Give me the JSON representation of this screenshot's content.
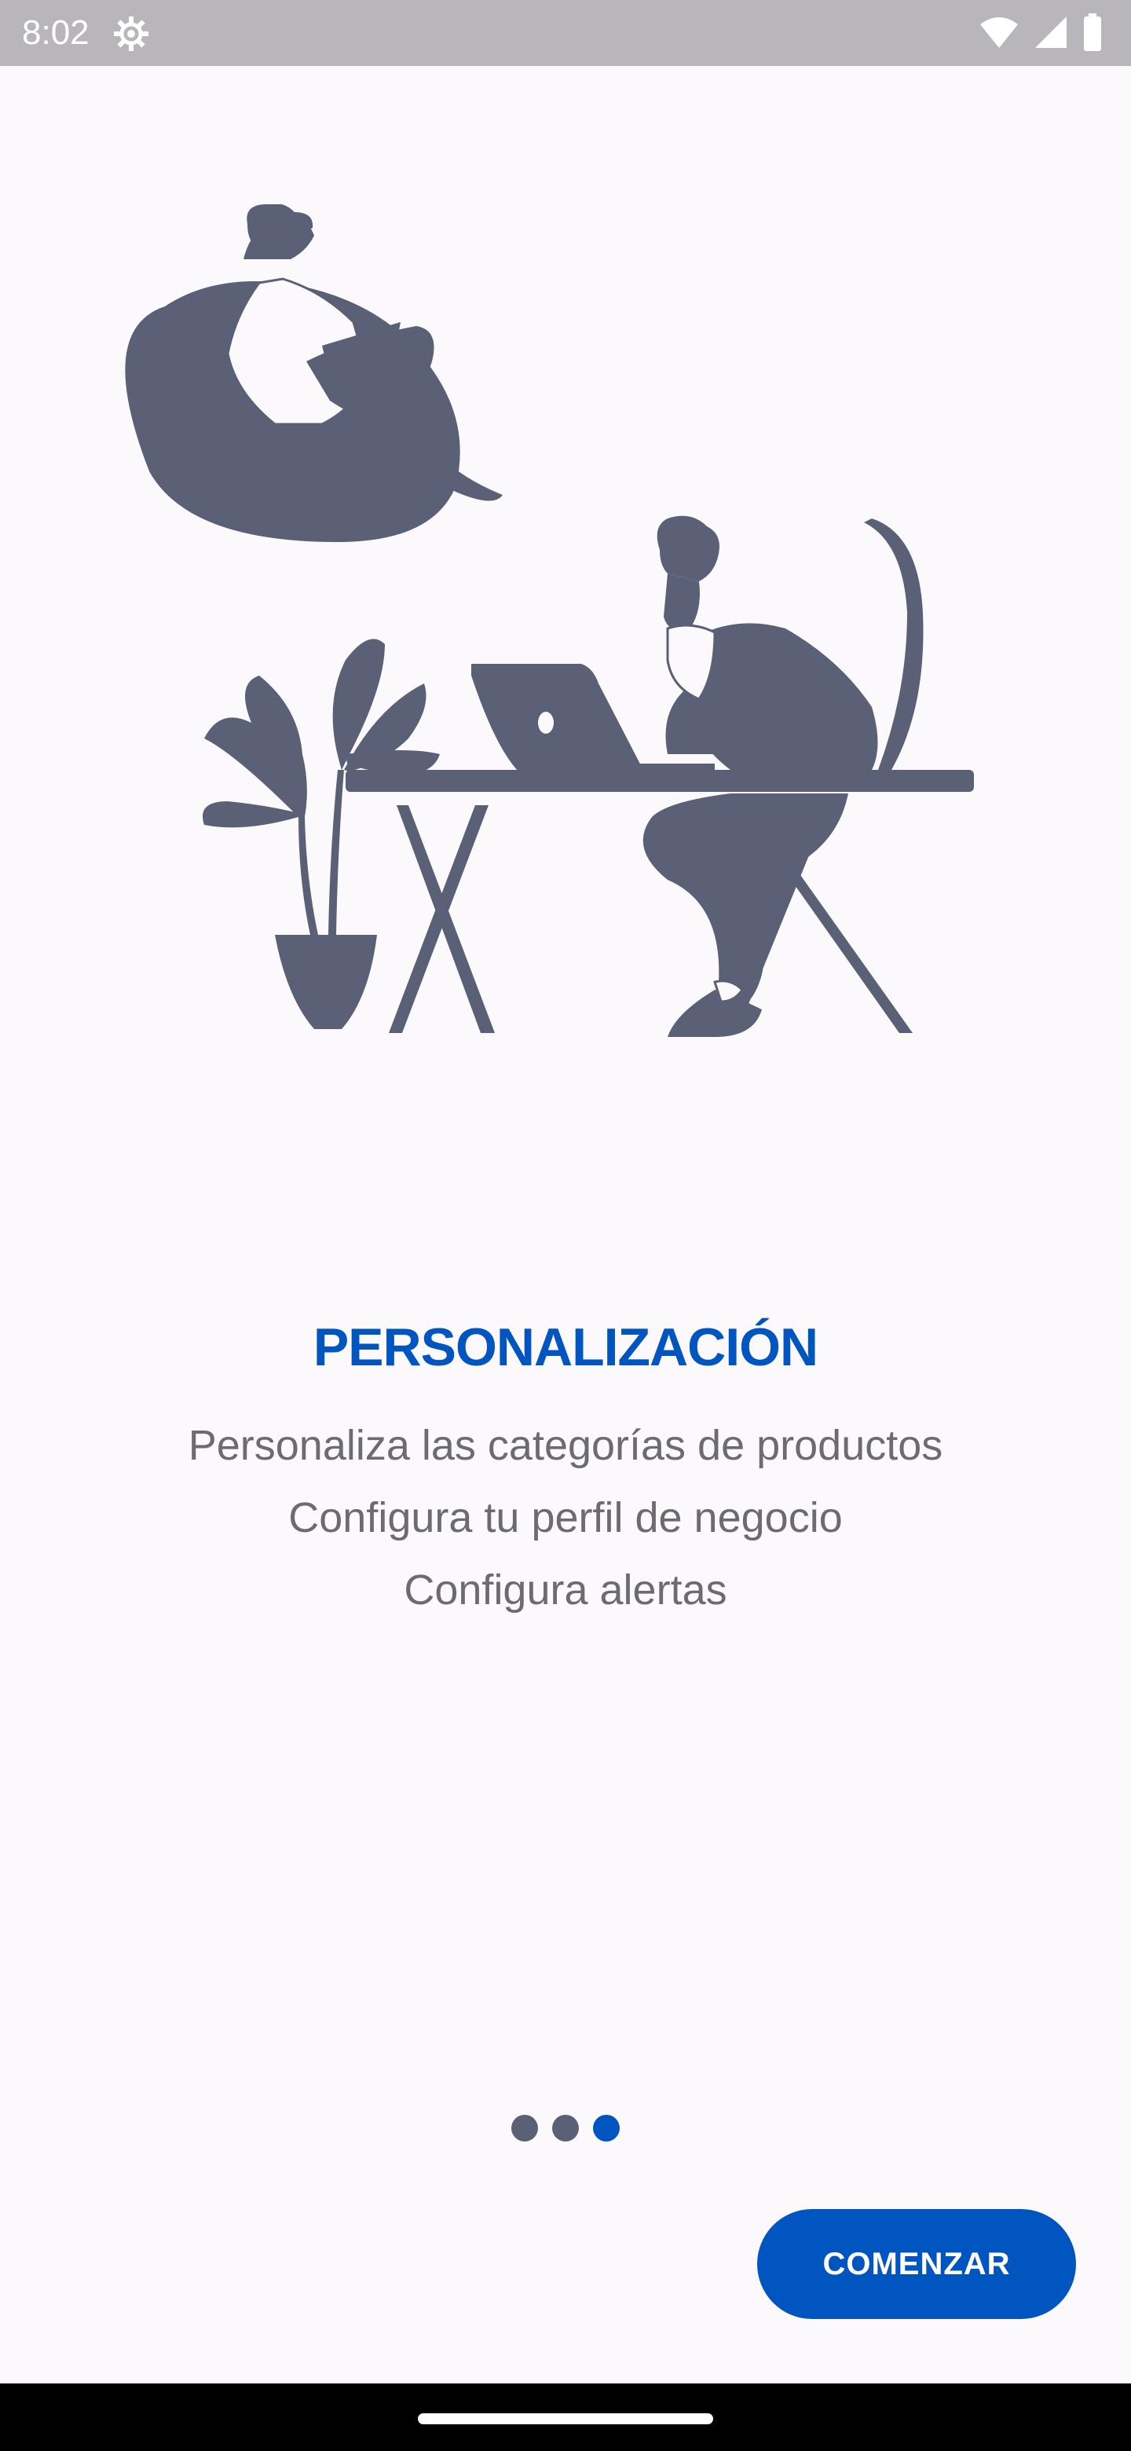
{
  "status_bar": {
    "time": "8:02",
    "icons": [
      "settings-gear-icon",
      "wifi-icon",
      "signal-icon",
      "battery-icon"
    ]
  },
  "onboarding": {
    "illustration": "person-working-illustration",
    "title": "PERSONALIZACIÓN",
    "lines": [
      "Personaliza las categorías de productos",
      "Configura tu perfil de negocio",
      "Configura alertas"
    ],
    "page_indicator": {
      "total": 3,
      "current": 3
    },
    "cta_label": "COMENZAR"
  },
  "colors": {
    "accent": "#0055c1",
    "illustration": "#5a6075",
    "background": "#fcf9fc",
    "body_text": "#6b6b70",
    "status_bar": "#b8b6bb"
  }
}
